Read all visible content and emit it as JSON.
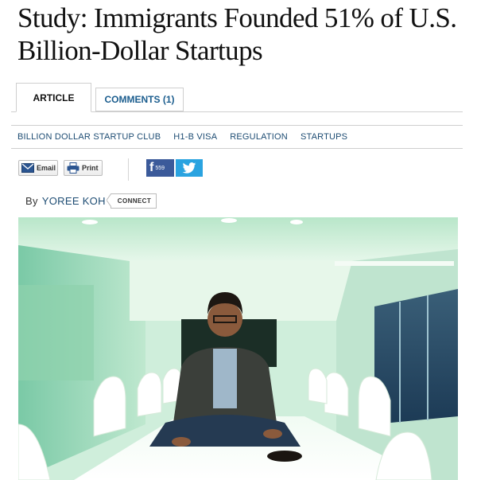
{
  "headline": "Study: Immigrants Founded 51% of U.S. Billion-Dollar Startups",
  "tabs": [
    {
      "label": "ARTICLE"
    },
    {
      "label": "COMMENTS (1)"
    }
  ],
  "topics": [
    "BILLION DOLLAR STARTUP CLUB",
    "H1-B VISA",
    "REGULATION",
    "STARTUPS"
  ],
  "share": {
    "email_label": "Email",
    "print_label": "Print",
    "facebook_count": "559"
  },
  "byline": {
    "prefix": "By",
    "author": "YOREE KOH",
    "connect_label": "CONNECT"
  },
  "colors": {
    "link": "#1d4c73",
    "facebook": "#3b5a9a",
    "twitter": "#2aa3e0"
  }
}
